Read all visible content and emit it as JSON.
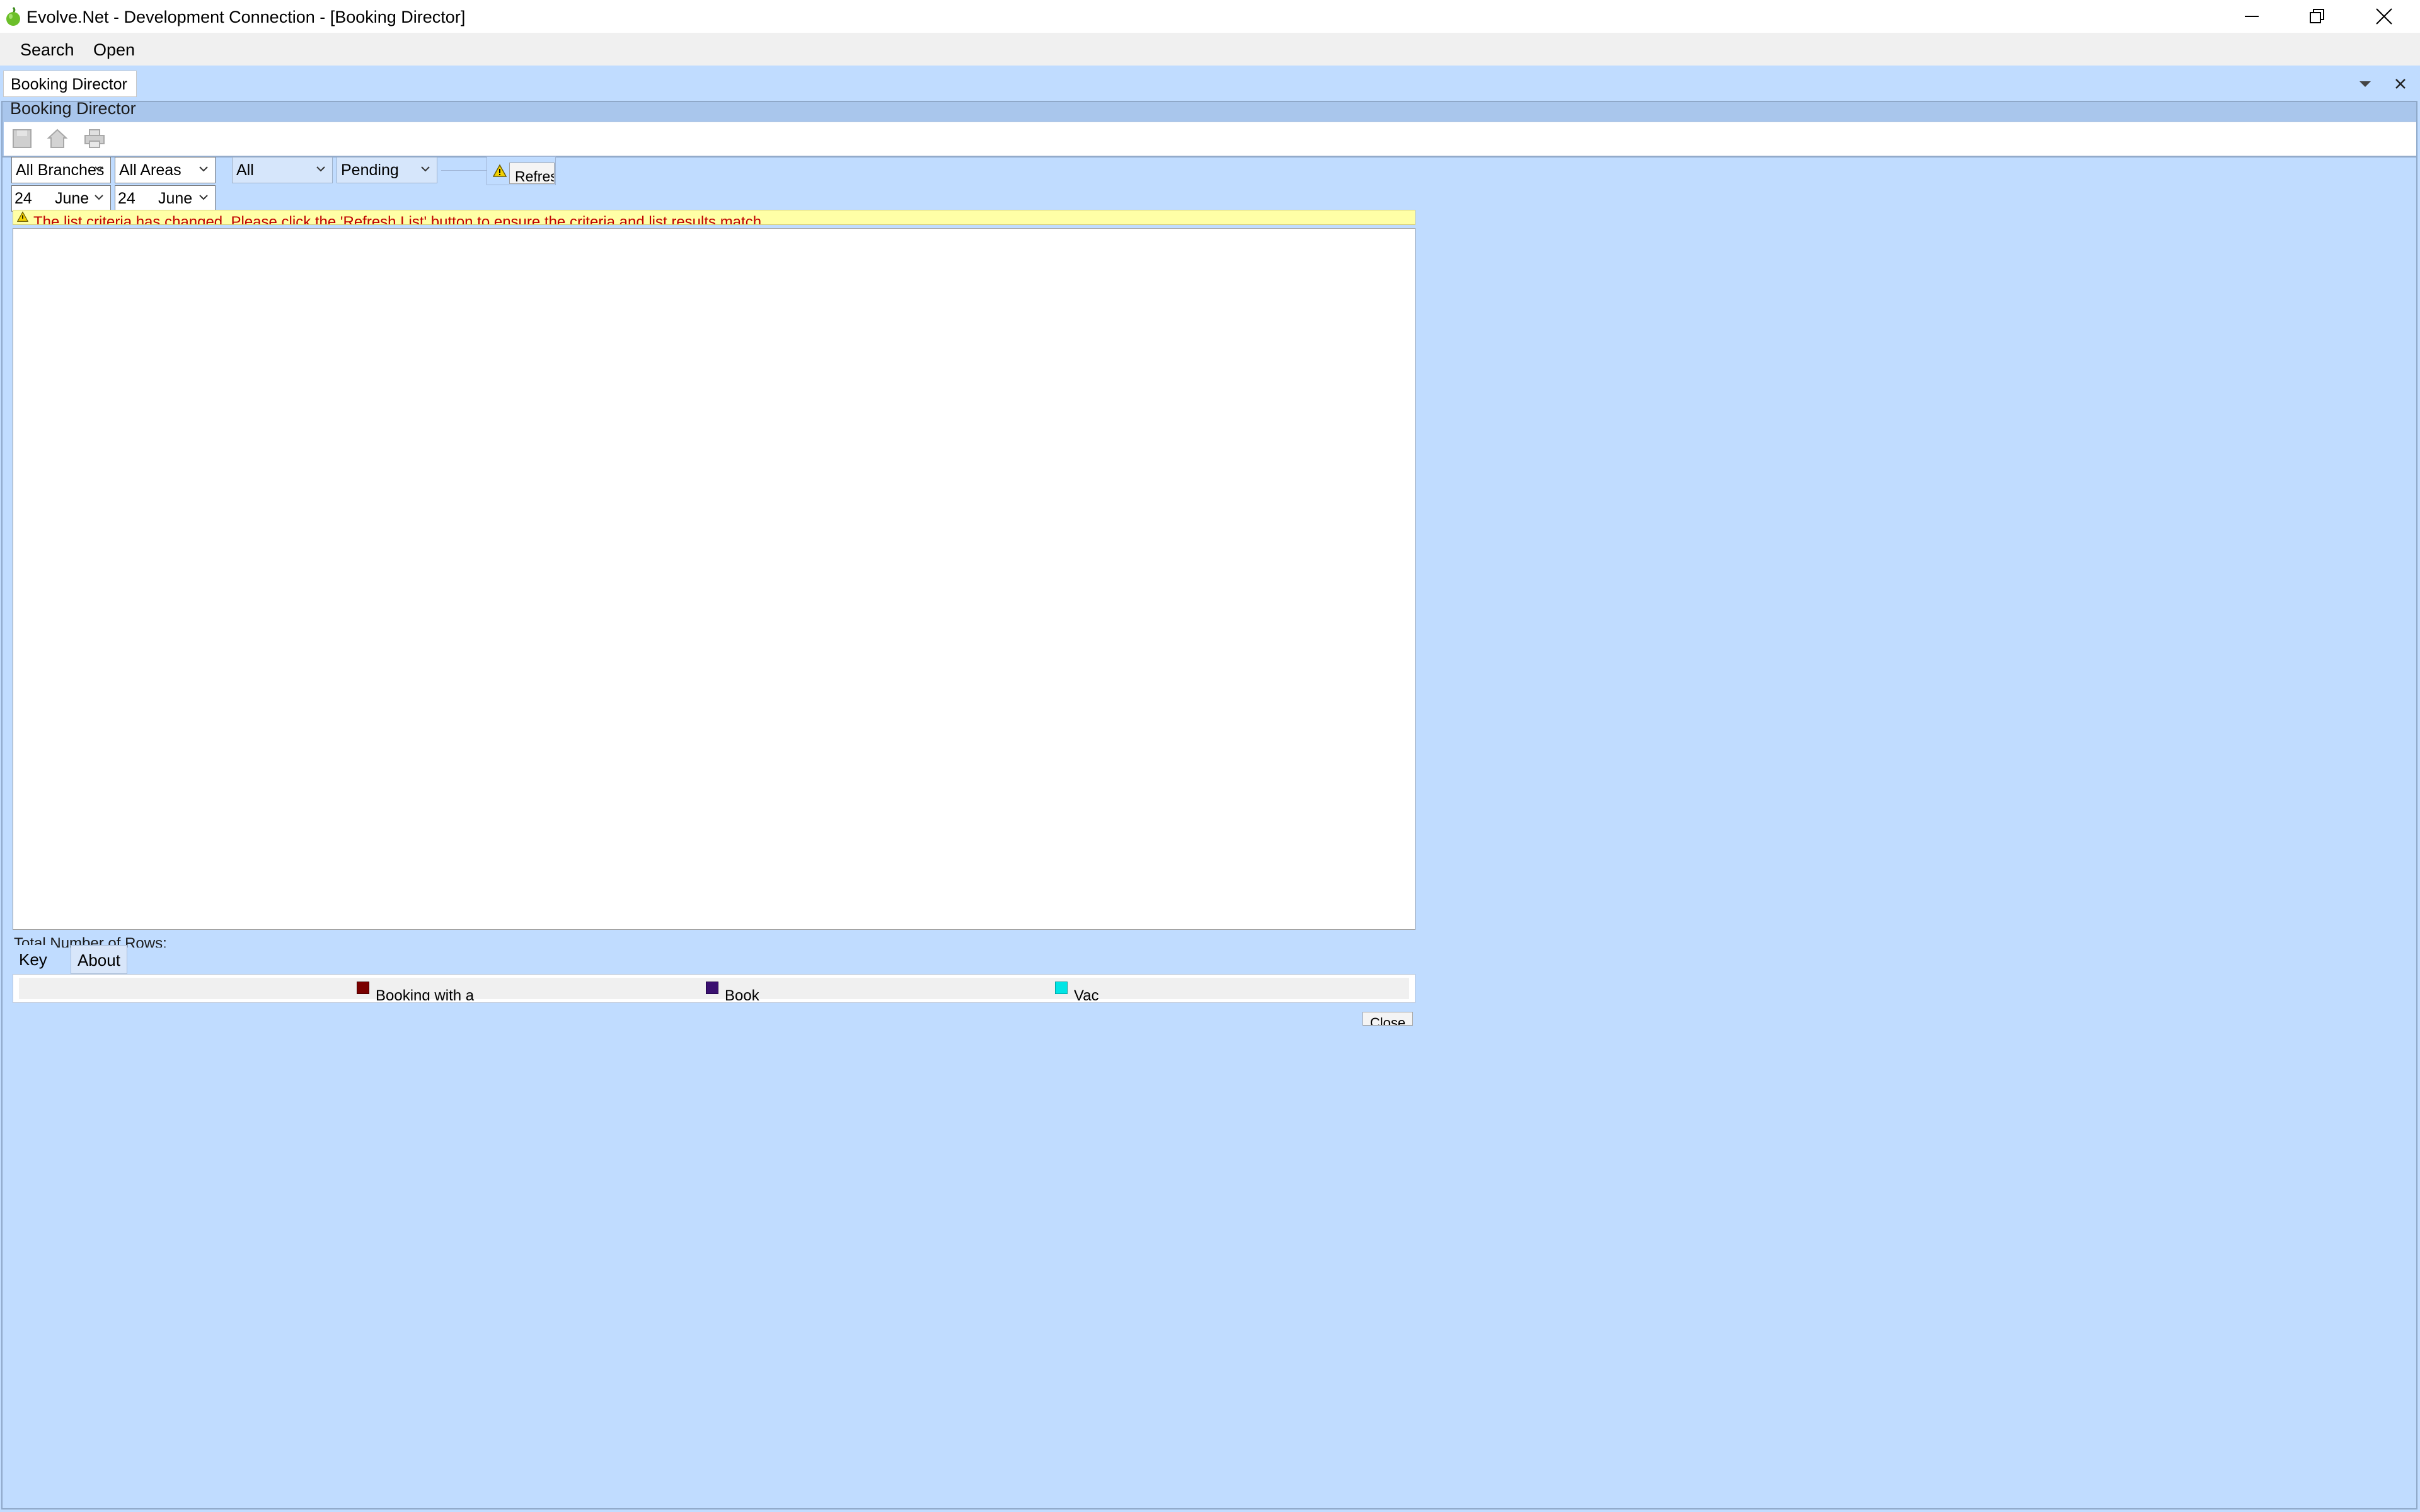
{
  "window": {
    "title": "Evolve.Net - Development Connection - [Booking Director]",
    "controls": [
      "minimize-icon",
      "restore-icon",
      "close-icon"
    ]
  },
  "menu": {
    "search": "Search",
    "open": "Open"
  },
  "document_tab": {
    "label": "Booking Director"
  },
  "panel": {
    "title": "Booking Director"
  },
  "toolbar": {
    "icons": [
      "save-icon",
      "home-icon",
      "print-icon"
    ]
  },
  "filters": {
    "branch": "All Branches",
    "area": "All Areas",
    "type": "All",
    "status": "Pending",
    "date_from_day": "24",
    "date_from_month": "June",
    "date_to_day": "24",
    "date_to_month": "June",
    "refresh_label": "Refresh List"
  },
  "warning": {
    "icon": "warning-icon",
    "text": "The list criteria has changed.  Please click the 'Refresh List' button to ensure the criteria and list results match."
  },
  "results": {
    "row_count_label": "Total Number of Rows:"
  },
  "tabs": {
    "key": "Key",
    "about": "About"
  },
  "key_legend": [
    {
      "label": "Booking with a",
      "color": "#7a0000"
    },
    {
      "label": "Book",
      "color": "#3a1070"
    },
    {
      "label": "Vac",
      "color": "#00e5e5"
    }
  ],
  "footer": {
    "close_label": "Close"
  }
}
